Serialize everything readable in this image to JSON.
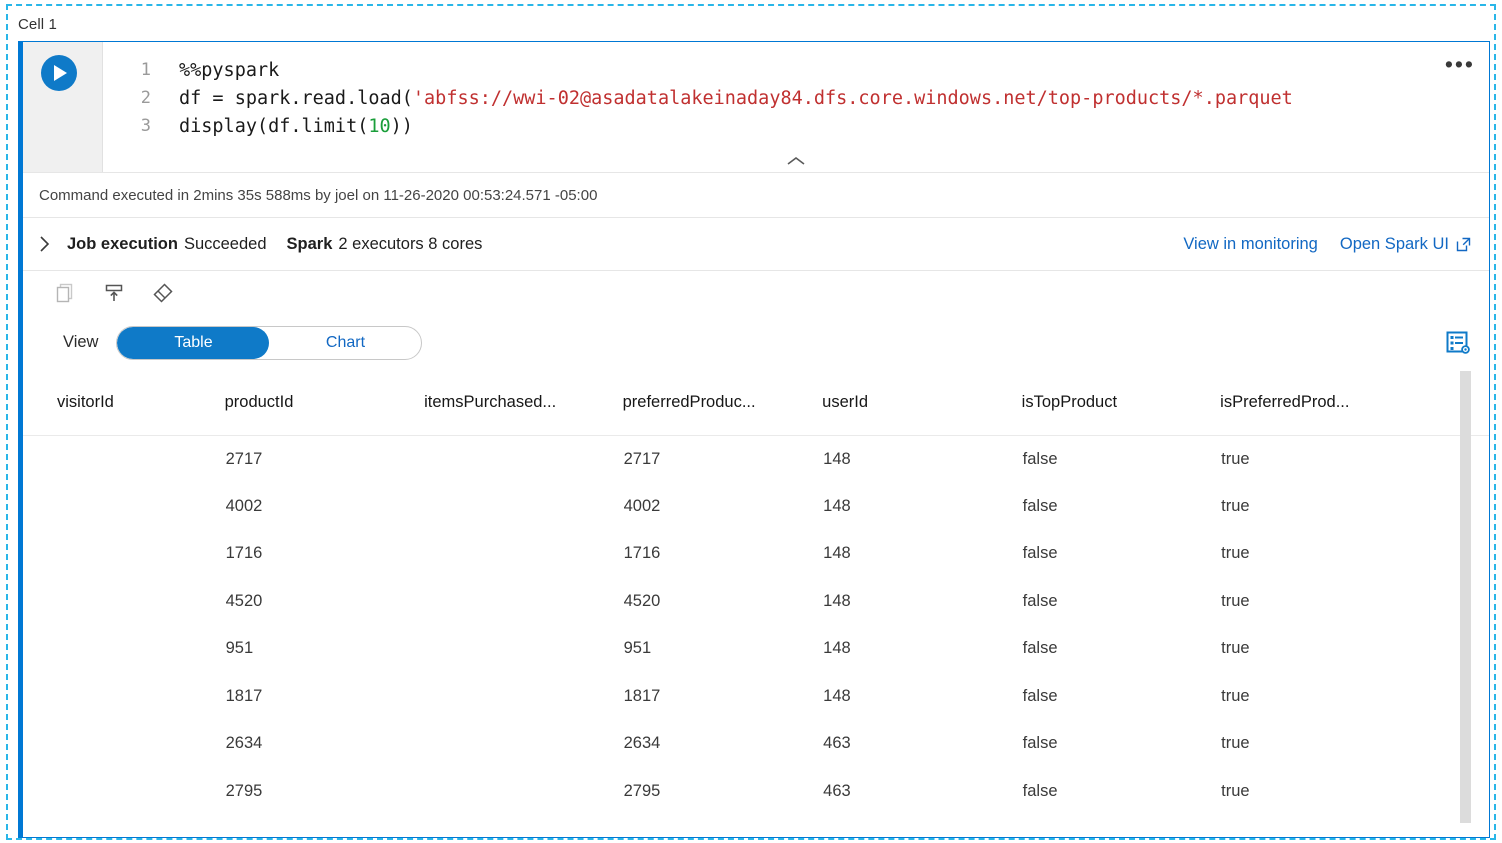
{
  "cell": {
    "label": "Cell 1",
    "menu_icon": "•••",
    "run_icon": "play-icon",
    "collapse_icon": "chevron-up-icon"
  },
  "code": {
    "lines": [
      {
        "no": "1",
        "segments": [
          {
            "text": "%%pyspark",
            "type": "plain"
          }
        ]
      },
      {
        "no": "2",
        "segments": [
          {
            "text": "df = spark.read.load(",
            "type": "plain"
          },
          {
            "text": "'abfss://wwi-02@asadatalakeinaday84.dfs.core.windows.net/top-products/*.parquet",
            "type": "string"
          }
        ]
      },
      {
        "no": "3",
        "segments": [
          {
            "text": "display(df.limit(",
            "type": "plain"
          },
          {
            "text": "10",
            "type": "number"
          },
          {
            "text": "))",
            "type": "plain"
          }
        ]
      }
    ],
    "line1_no": "1",
    "line1_text": "%%pyspark",
    "line2_no": "2",
    "line2_prefix": "df = spark.read.load(",
    "line2_string": "'abfss://wwi-02@asadatalakeinaday84.dfs.core.windows.net/top-products/*.parquet",
    "line3_no": "3",
    "line3_prefix": "display(df.limit(",
    "line3_number": "10",
    "line3_suffix": "))"
  },
  "execution": {
    "status_text": "Command executed in 2mins 35s 588ms by joel on 11-26-2020 00:53:24.571 -05:00",
    "job_label": "Job execution",
    "job_status": "Succeeded",
    "spark_label": "Spark",
    "spark_detail": "2 executors 8 cores",
    "link_monitoring": "View in monitoring",
    "link_spark_ui": "Open Spark UI"
  },
  "toolbar": {
    "icons": [
      {
        "name": "copy-icon",
        "title": "Copy"
      },
      {
        "name": "export-icon",
        "title": "Save output"
      },
      {
        "name": "eraser-icon",
        "title": "Clear output"
      }
    ]
  },
  "view": {
    "label": "View",
    "table_tab": "Table",
    "chart_tab": "Chart",
    "active_tab": "Table",
    "config_icon": "table-settings-icon",
    "accent_color": "#0f7ac8"
  },
  "results": {
    "columns": [
      "visitorId",
      "productId",
      "itemsPurchased...",
      "preferredProduc...",
      "userId",
      "isTopProduct",
      "isPreferredProd..."
    ],
    "rows": [
      [
        "",
        "2717",
        "",
        "2717",
        "148",
        "false",
        "true"
      ],
      [
        "",
        "4002",
        "",
        "4002",
        "148",
        "false",
        "true"
      ],
      [
        "",
        "1716",
        "",
        "1716",
        "148",
        "false",
        "true"
      ],
      [
        "",
        "4520",
        "",
        "4520",
        "148",
        "false",
        "true"
      ],
      [
        "",
        "951",
        "",
        "951",
        "148",
        "false",
        "true"
      ],
      [
        "",
        "1817",
        "",
        "1817",
        "148",
        "false",
        "true"
      ],
      [
        "",
        "2634",
        "",
        "2634",
        "463",
        "false",
        "true"
      ],
      [
        "",
        "2795",
        "",
        "2795",
        "463",
        "false",
        "true"
      ]
    ]
  }
}
